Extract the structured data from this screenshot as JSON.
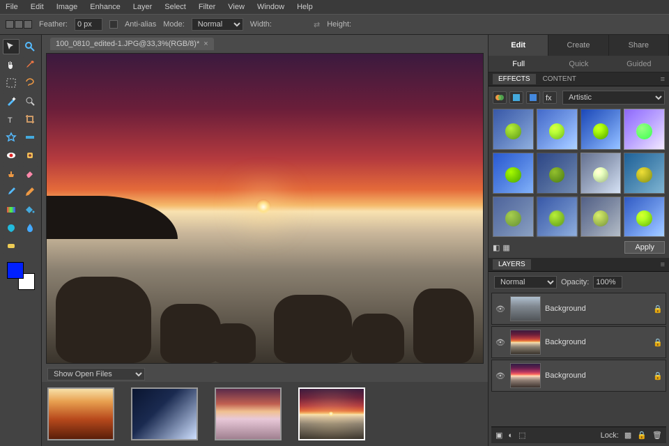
{
  "menu": [
    "File",
    "Edit",
    "Image",
    "Enhance",
    "Layer",
    "Select",
    "Filter",
    "View",
    "Window",
    "Help"
  ],
  "options": {
    "feather_label": "Feather:",
    "feather_value": "0 px",
    "antialias_label": "Anti-alias",
    "mode_label": "Mode:",
    "mode_value": "Normal",
    "width_label": "Width:",
    "height_label": "Height:"
  },
  "document": {
    "tab_title": "100_0810_edited-1.JPG@33,3%(RGB/8)*"
  },
  "open_files": {
    "dropdown": "Show Open Files"
  },
  "right_tabs": {
    "edit": "Edit",
    "create": "Create",
    "share": "Share"
  },
  "sub_tabs": {
    "full": "Full",
    "quick": "Quick",
    "guided": "Guided"
  },
  "effects_panel": {
    "tab_effects": "EFFECTS",
    "tab_content": "CONTENT",
    "category": "Artistic",
    "apply": "Apply"
  },
  "layers_panel": {
    "title": "LAYERS",
    "blend": "Normal",
    "opacity_label": "Opacity:",
    "opacity_value": "100%",
    "items": [
      {
        "name": "Background"
      },
      {
        "name": "Background"
      },
      {
        "name": "Background"
      }
    ],
    "lock_label": "Lock:"
  },
  "tools": {
    "row0": [
      "move-tool",
      "zoom-tool"
    ],
    "row1": [
      "hand-tool",
      "eyedropper-tool"
    ],
    "row2": [
      "marquee-tool",
      "lasso-tool"
    ],
    "row3": [
      "magic-wand-tool",
      "quick-selection-tool"
    ],
    "row4": [
      "type-tool",
      "crop-tool"
    ],
    "row5": [
      "cookie-cutter-tool",
      "straighten-tool"
    ],
    "row6": [
      "red-eye-tool",
      "healing-brush-tool"
    ],
    "row7": [
      "clone-stamp-tool",
      "eraser-tool"
    ],
    "row8": [
      "brush-tool",
      "pencil-tool"
    ],
    "row9": [
      "gradient-tool",
      "paint-bucket-tool"
    ],
    "row10": [
      "shape-tool",
      "blur-tool"
    ],
    "row11": [
      "sponge-tool",
      ""
    ]
  },
  "colors": {
    "fg": "#0020ff",
    "bg": "#ffffff"
  }
}
